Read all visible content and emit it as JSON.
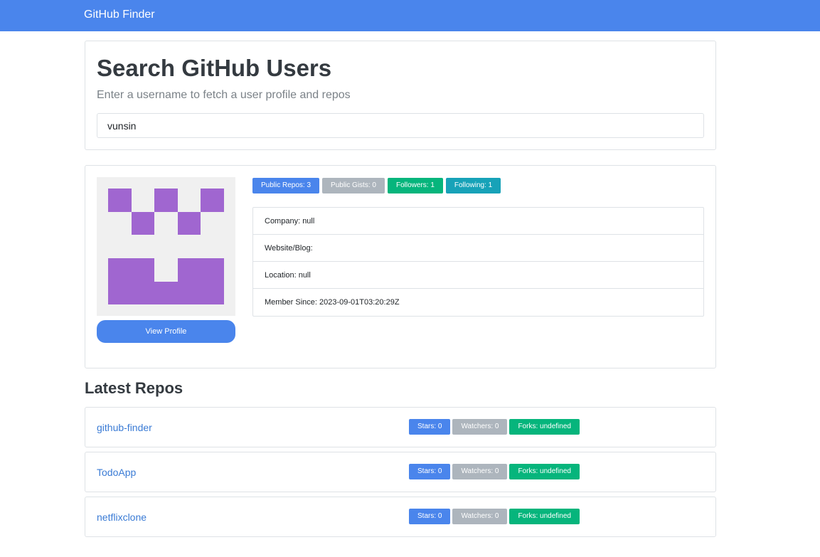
{
  "navbar": {
    "brand": "GitHub Finder"
  },
  "search": {
    "title": "Search GitHub Users",
    "subtitle": "Enter a username to fetch a user profile and repos",
    "value": "vunsin"
  },
  "profile": {
    "avatar_color": "#a066d0",
    "view_profile_label": "View Profile",
    "badges": {
      "repos": "Public Repos: 3",
      "gists": "Public Gists: 0",
      "followers": "Followers: 1",
      "following": "Following: 1"
    },
    "details": {
      "company": "Company: null",
      "website": "Website/Blog:",
      "location": "Location: null",
      "member_since": "Member Since: 2023-09-01T03:20:29Z"
    }
  },
  "repos_section": {
    "title": "Latest Repos",
    "items": [
      {
        "name": "github-finder",
        "stars": "Stars: 0",
        "watchers": "Watchers: 0",
        "forks": "Forks: undefined"
      },
      {
        "name": "TodoApp",
        "stars": "Stars: 0",
        "watchers": "Watchers: 0",
        "forks": "Forks: undefined"
      },
      {
        "name": "netflixclone",
        "stars": "Stars: 0",
        "watchers": "Watchers: 0",
        "forks": "Forks: undefined"
      }
    ]
  },
  "colors": {
    "primary": "#4a85ec",
    "secondary": "#adb5bd",
    "success": "#06b57c",
    "info": "#17a2b8"
  }
}
